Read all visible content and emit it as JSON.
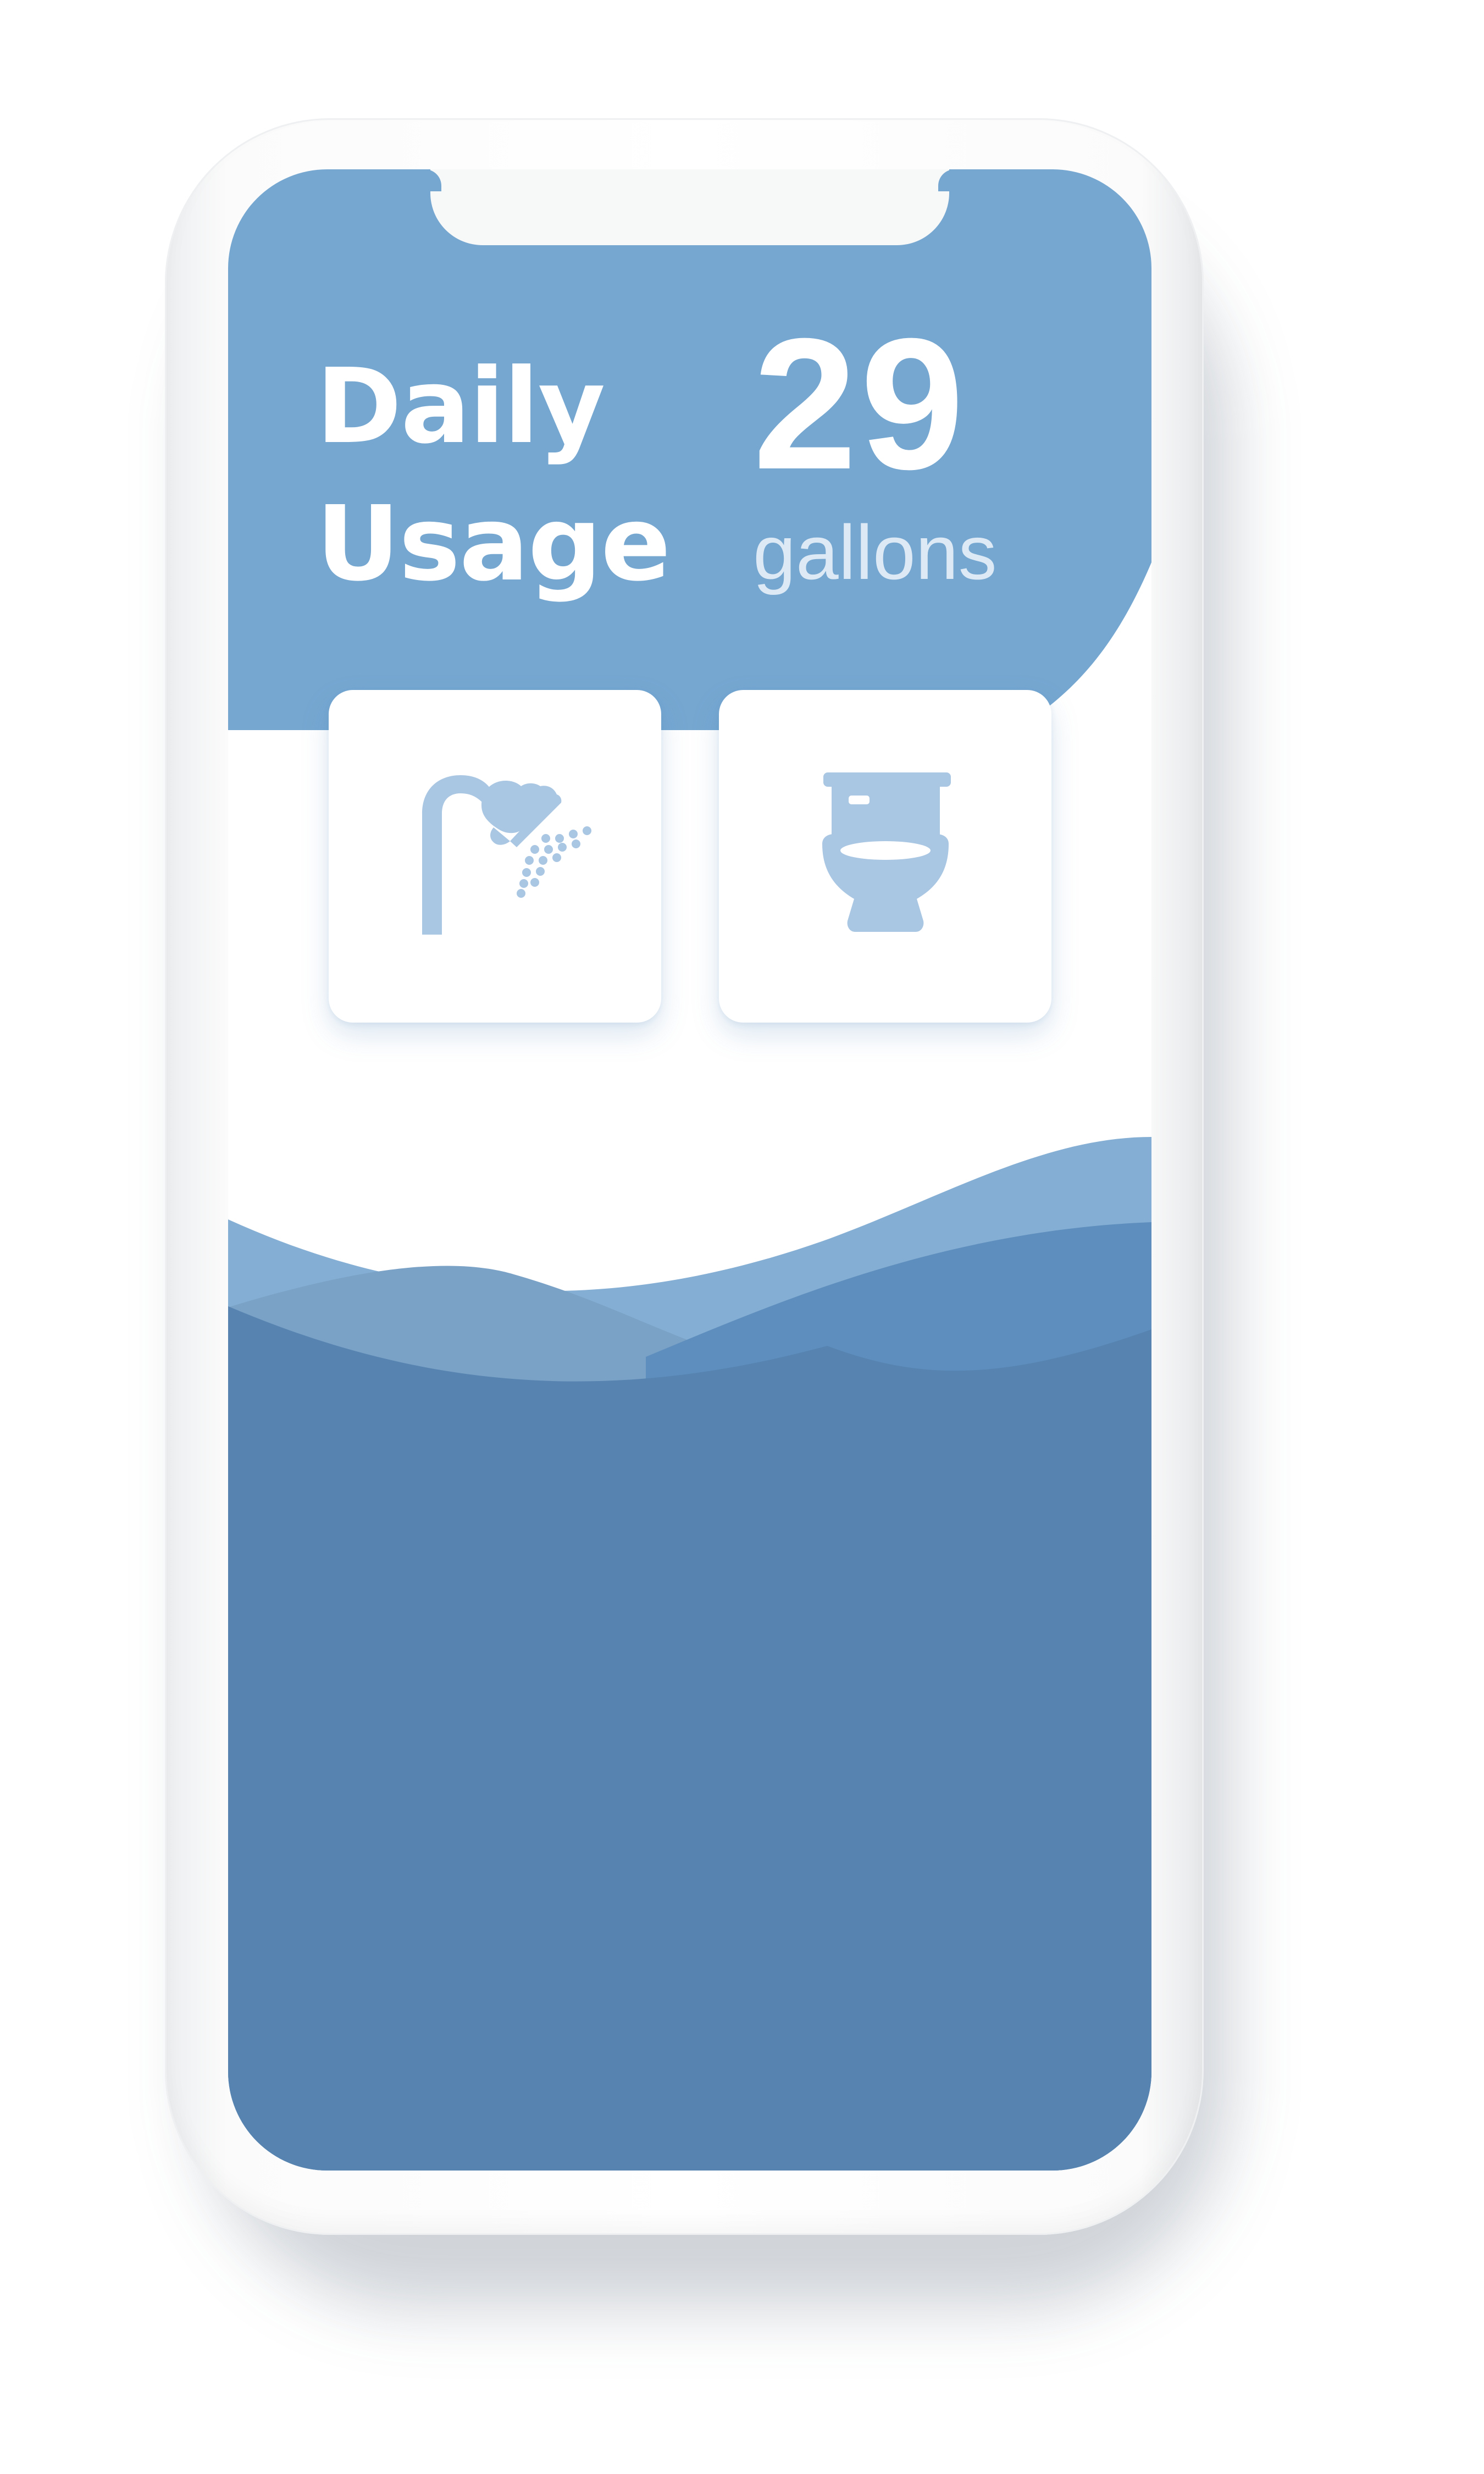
{
  "header": {
    "title_line1": "Daily",
    "title_line2": "Usage",
    "usage_value": "29",
    "usage_unit": "gallons"
  },
  "fixtures": [
    {
      "name": "shower",
      "icon": "shower-icon"
    },
    {
      "name": "toilet",
      "icon": "toilet-icon"
    }
  ],
  "colors": {
    "header_blue": "#75A7D1",
    "wave_light": "#84AED3",
    "wave_mid": "#5E8EBE",
    "water_deep": "#5683B0",
    "icon_tint": "#A9C6E3",
    "card_bg": "#FFFFFF"
  }
}
